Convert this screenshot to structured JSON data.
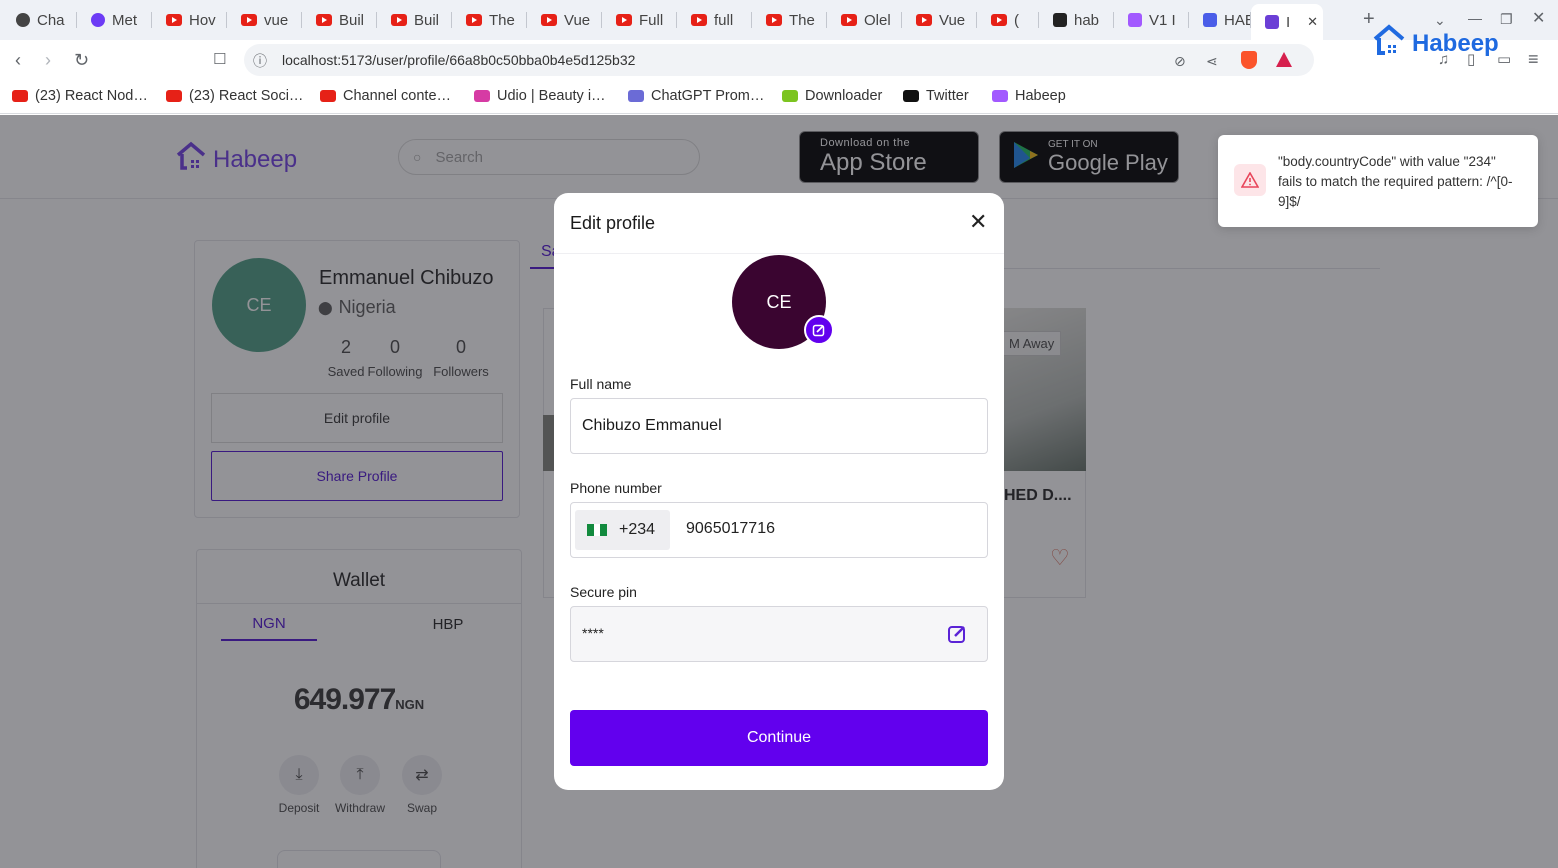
{
  "tabs": [
    {
      "title": "Cha",
      "icon": "openai-icon",
      "color": "#444"
    },
    {
      "title": "Met",
      "icon": "meta-icon",
      "color": "#6c3bf5"
    },
    {
      "title": "Hov",
      "icon": "youtube-icon",
      "color": "#e62117"
    },
    {
      "title": "vue",
      "icon": "youtube-icon",
      "color": "#e62117"
    },
    {
      "title": "Buil",
      "icon": "youtube-icon",
      "color": "#e62117"
    },
    {
      "title": "Buil",
      "icon": "youtube-icon",
      "color": "#e62117"
    },
    {
      "title": "The",
      "icon": "youtube-icon",
      "color": "#e62117"
    },
    {
      "title": "Vue",
      "icon": "youtube-icon",
      "color": "#e62117"
    },
    {
      "title": "Full",
      "icon": "youtube-icon",
      "color": "#e62117"
    },
    {
      "title": "full",
      "icon": "youtube-icon",
      "color": "#e62117"
    },
    {
      "title": "The",
      "icon": "youtube-icon",
      "color": "#e62117"
    },
    {
      "title": "Olel",
      "icon": "youtube-icon",
      "color": "#e62117"
    },
    {
      "title": "Vue",
      "icon": "youtube-icon",
      "color": "#e62117"
    },
    {
      "title": "(",
      "icon": "youtube-icon",
      "color": "#e62117"
    },
    {
      "title": "hab",
      "icon": "github-icon",
      "color": "#222"
    },
    {
      "title": "V1 I",
      "icon": "figma-icon",
      "color": "#a259ff"
    },
    {
      "title": "HAE",
      "icon": "docs-icon",
      "color": "#4a5de8"
    },
    {
      "title": "I",
      "icon": "habeep-icon",
      "color": "#6b3fd6"
    }
  ],
  "address": {
    "url": "localhost:5173/user/profile/66a8b0c50bba0b4e5d125b32"
  },
  "bookmarks": [
    {
      "label": "(23) React Nod…",
      "color": "#e62117"
    },
    {
      "label": "(23) React Soci…",
      "color": "#e62117"
    },
    {
      "label": "Channel conte…",
      "color": "#e62117"
    },
    {
      "label": "Udio | Beauty i…",
      "color": "#d63ba4"
    },
    {
      "label": "ChatGPT Prom…",
      "color": "#6b6bd6"
    },
    {
      "label": "Downloader",
      "color": "#7cc420"
    },
    {
      "label": "Twitter",
      "color": "#111"
    },
    {
      "label": "Habeep",
      "color": "#a259ff"
    }
  ],
  "site": {
    "brand": "Habeep",
    "search_placeholder": "Search",
    "appstore_small": "Download on the",
    "appstore_big": "App Store",
    "gplay_small": "GET IT ON",
    "gplay_big": "Google Play",
    "tab_partial": "Sa",
    "overlay_badge": "M Away",
    "property_title": "HED D....",
    "profile": {
      "initials": "CE",
      "name": "Emmanuel Chibuzo",
      "country": "Nigeria",
      "stats": [
        {
          "value": "2",
          "label": "Saved"
        },
        {
          "value": "0",
          "label": "Following"
        },
        {
          "value": "0",
          "label": "Followers"
        }
      ],
      "edit_label": "Edit profile",
      "share_label": "Share Profile"
    },
    "wallet": {
      "title": "Wallet",
      "tabs": [
        "NGN",
        "HBP"
      ],
      "amount": "649.977",
      "currency": "NGN",
      "actions": [
        {
          "label": "Deposit",
          "icon": "deposit-icon"
        },
        {
          "label": "Withdraw",
          "icon": "withdraw-icon"
        },
        {
          "label": "Swap",
          "icon": "swap-icon"
        }
      ]
    }
  },
  "modal": {
    "title": "Edit profile",
    "avatar_initials": "CE",
    "full_name_label": "Full name",
    "full_name_value": "Chibuzo Emmanuel",
    "phone_label": "Phone number",
    "country_code": "+234",
    "phone_value": "9065017716",
    "pin_label": "Secure pin",
    "pin_value": "****",
    "continue_label": "Continue",
    "accent": "#6200ee"
  },
  "toast": {
    "message": "\"body.countryCode\" with value \"234\" fails to match the required pattern: /^[0-9]$/"
  }
}
